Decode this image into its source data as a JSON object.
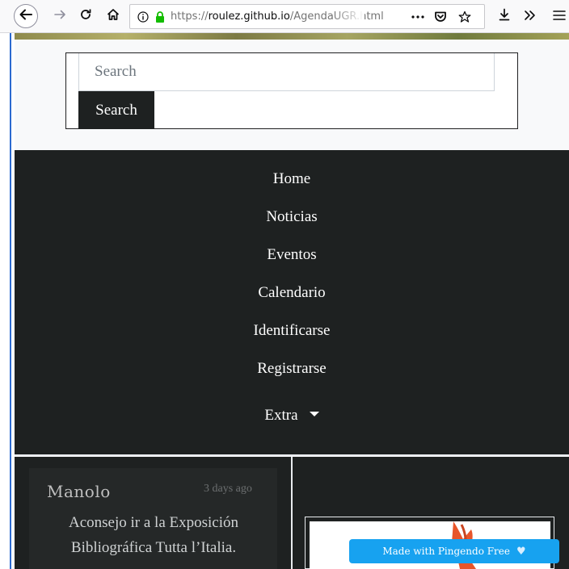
{
  "browser": {
    "url_prefix": "https://",
    "url_host": "roulez.github.io",
    "url_path": "/AgendaUGR.html",
    "icons": {
      "back": "back-arrow-icon",
      "forward": "forward-arrow-icon",
      "reload": "reload-icon",
      "home": "home-icon",
      "info": "info-icon",
      "lock": "lock-icon",
      "more": "more-dots-icon",
      "pocket": "pocket-icon",
      "star": "star-icon",
      "download": "download-icon",
      "overflow": "overflow-chevrons-icon",
      "menu": "hamburger-menu-icon"
    }
  },
  "search": {
    "placeholder": "Search",
    "button_label": "Search"
  },
  "nav": {
    "items": [
      {
        "label": "Home"
      },
      {
        "label": "Noticias"
      },
      {
        "label": "Eventos"
      },
      {
        "label": "Calendario"
      },
      {
        "label": "Identificarse"
      },
      {
        "label": "Registrarse"
      }
    ],
    "extra_label": "Extra"
  },
  "post": {
    "author": "Manolo",
    "time": "3 days ago",
    "text": "Aconsejo ir a la Exposición Bibliográfica Tutta l’Italia."
  },
  "badge": {
    "label": "Made with Pingendo Free"
  },
  "colors": {
    "nav_bg": "#1e2121",
    "badge_bg": "#17a2f0",
    "lock_green": "#12bc00"
  }
}
